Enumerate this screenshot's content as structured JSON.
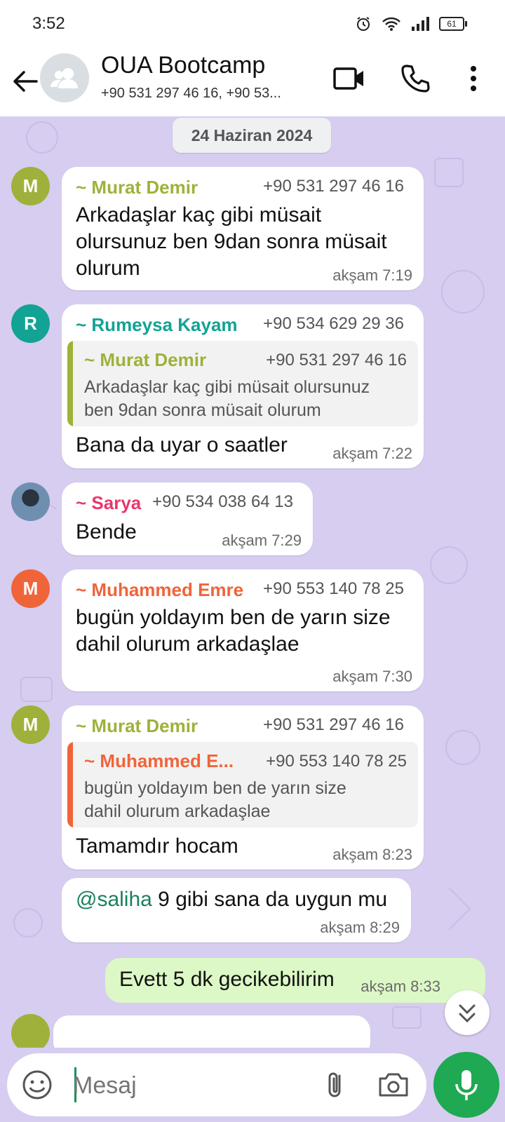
{
  "status": {
    "time": "3:52",
    "battery": "61"
  },
  "header": {
    "title": "OUA Bootcamp",
    "subtitle": "+90 531 297 46 16, +90 53..."
  },
  "chat": {
    "date": "24 Haziran 2024",
    "messages": [
      {
        "initial": "M",
        "sender": "~ Murat Demir",
        "phone": "+90 531 297 46 16",
        "lines": [
          "Arkadaşlar kaç gibi müsait",
          "olursunuz ben 9dan sonra müsait",
          "olurum"
        ],
        "time": "akşam 7:19"
      },
      {
        "initial": "R",
        "sender": "~ Rumeysa Kayam",
        "phone": "+90 534 629 29 36",
        "quote": {
          "sender": "~ Murat Demir",
          "phone": "+90 531 297 46 16",
          "lines": [
            "Arkadaşlar kaç gibi müsait olursunuz",
            "ben 9dan sonra müsait olurum"
          ]
        },
        "lines": [
          "Bana da uyar o saatler"
        ],
        "time": "akşam 7:22"
      },
      {
        "sender": "~ Sarya",
        "phone": "+90 534 038 64 13",
        "lines": [
          "Bende"
        ],
        "time": "akşam 7:29"
      },
      {
        "initial": "M",
        "sender": "~ Muhammed Emre",
        "phone": "+90 553 140 78 25",
        "lines": [
          "bugün yoldayım ben de yarın size",
          "dahil olurum arkadaşlae"
        ],
        "time": "akşam 7:30"
      },
      {
        "initial": "M",
        "sender": "~ Murat Demir",
        "phone": "+90 531 297 46 16",
        "quote": {
          "sender": "~ Muhammed E...",
          "phone": "+90 553 140 78 25",
          "lines": [
            "bugün yoldayım ben de yarın size",
            "dahil olurum arkadaşlae"
          ]
        },
        "lines": [
          "Tamamdır hocam"
        ],
        "time": "akşam 8:23"
      },
      {
        "mention": "@saliha",
        "text": " 9 gibi sana da uygun mu",
        "time": "akşam 8:29"
      }
    ],
    "outgoing": {
      "text": "Evett 5 dk gecikebilirim",
      "time": "akşam 8:33"
    }
  },
  "composer": {
    "placeholder": "Mesaj"
  },
  "colors": {
    "murat": "#9fb13a",
    "rumeysa": "#12a394",
    "sarya": "#e8386b",
    "muhammed": "#f0643a",
    "chat_bg": "#d6cdf0",
    "outgoing_bg": "#dcf8c6",
    "accent": "#1ea952"
  },
  "icons": [
    "back-arrow-icon",
    "group-icon",
    "video-camera-icon",
    "phone-icon",
    "more-vert-icon",
    "emoji-icon",
    "paperclip-icon",
    "camera-icon",
    "mic-icon",
    "double-chevron-down-icon"
  ]
}
